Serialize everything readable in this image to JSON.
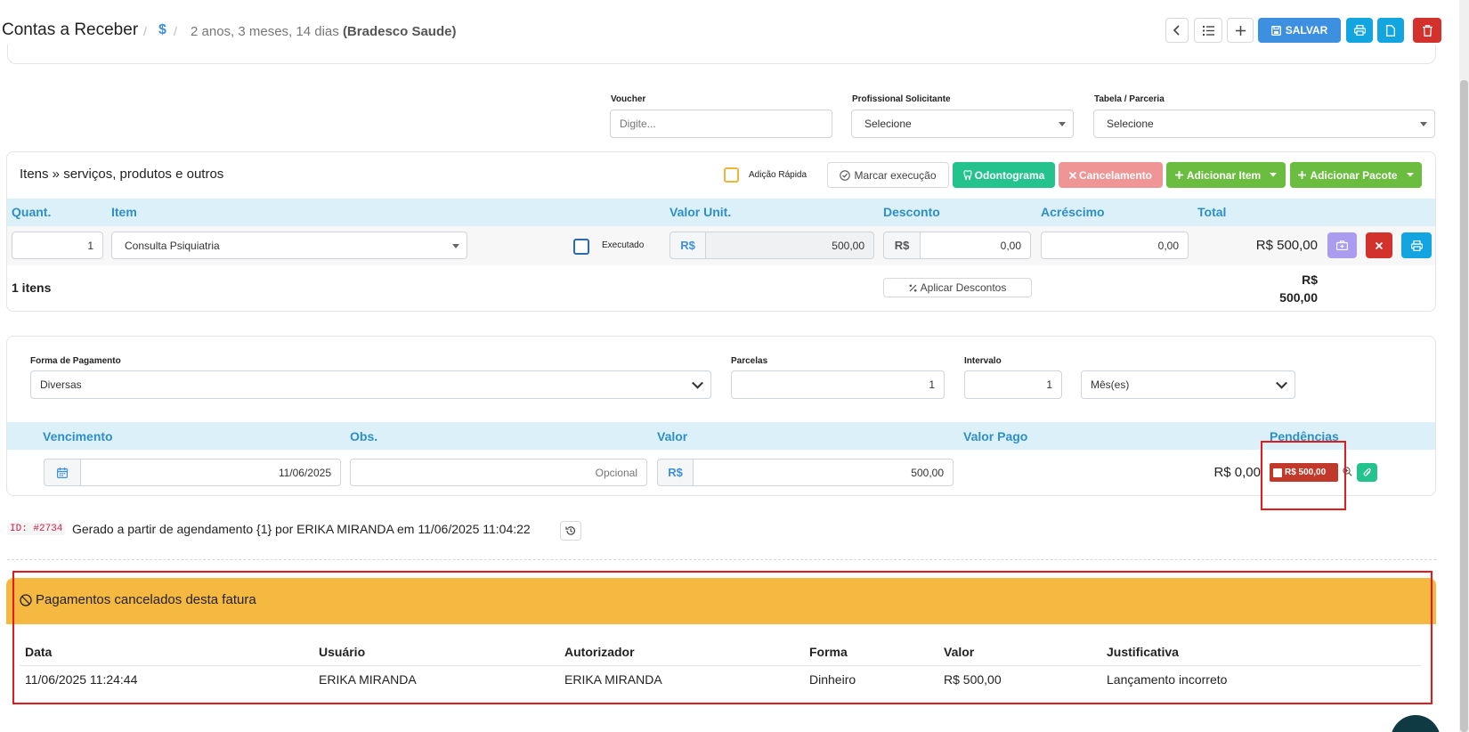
{
  "header": {
    "title": "Contas a Receber",
    "crumb_dollar": "$",
    "crumb_text": "2 anos, 3 meses, 14 dias",
    "crumb_patient": "(Bradesco Saude)",
    "save_label": "SALVAR"
  },
  "top_form": {
    "voucher_label": "Voucher",
    "voucher_placeholder": "Digite...",
    "prof_label": "Profissional Solicitante",
    "prof_value": "Selecione",
    "tabela_label": "Tabela / Parceria",
    "tabela_value": "Selecione"
  },
  "items": {
    "title": "Itens » serviços, produtos e outros",
    "adicao_rapida": "Adição Rápida",
    "marcar_execucao": "Marcar execução",
    "odontograma": "Odontograma",
    "cancelamento": "Cancelamento",
    "adicionar_item": "Adicionar Item",
    "adicionar_pacote": "Adicionar Pacote",
    "columns": {
      "quant": "Quant.",
      "item": "Item",
      "valor_unit": "Valor Unit.",
      "desconto": "Desconto",
      "acrescimo": "Acréscimo",
      "total": "Total"
    },
    "row": {
      "quant": "1",
      "item": "Consulta Psiquiatria",
      "executado": "Executado",
      "currency": "R$",
      "valor_unit": "500,00",
      "desconto": "0,00",
      "acrescimo": "0,00",
      "total": "R$ 500,00"
    },
    "footer_count": "1 itens",
    "aplicar_descontos": "Aplicar Descontos",
    "footer_total_cur": "R$",
    "footer_total_val": "500,00"
  },
  "payment": {
    "forma_label": "Forma de Pagamento",
    "forma_value": "Diversas",
    "parcelas_label": "Parcelas",
    "parcelas_value": "1",
    "intervalo_label": "Intervalo",
    "intervalo_value": "1",
    "periodo_value": "Mês(es)",
    "columns": {
      "vencimento": "Vencimento",
      "obs": "Obs.",
      "valor": "Valor",
      "valor_pago": "Valor Pago",
      "pendencias": "Pendências"
    },
    "row": {
      "vencimento": "11/06/2025",
      "obs_placeholder": "Opcional",
      "currency": "R$",
      "valor": "500,00",
      "valor_pago": "R$ 0,00",
      "pendencia_badge": "R$ 500,00"
    }
  },
  "meta": {
    "id_badge": "ID: #2734",
    "generated_text": "Gerado a partir de agendamento {1} por ERIKA MIRANDA em 11/06/2025 11:04:22"
  },
  "cancelled": {
    "title": "Pagamentos cancelados desta fatura",
    "columns": [
      "Data",
      "Usuário",
      "Autorizador",
      "Forma",
      "Valor",
      "Justificativa"
    ],
    "rows": [
      [
        "11/06/2025 11:24:44",
        "ERIKA MIRANDA",
        "ERIKA MIRANDA",
        "Dinheiro",
        "R$ 500,00",
        "Lançamento incorreto"
      ]
    ]
  },
  "colors": {
    "accent": "#3d8fe0",
    "table_header_bg": "#dcf0fa",
    "warning_bg": "#f5b942",
    "highlight_box": "#e8181f"
  }
}
